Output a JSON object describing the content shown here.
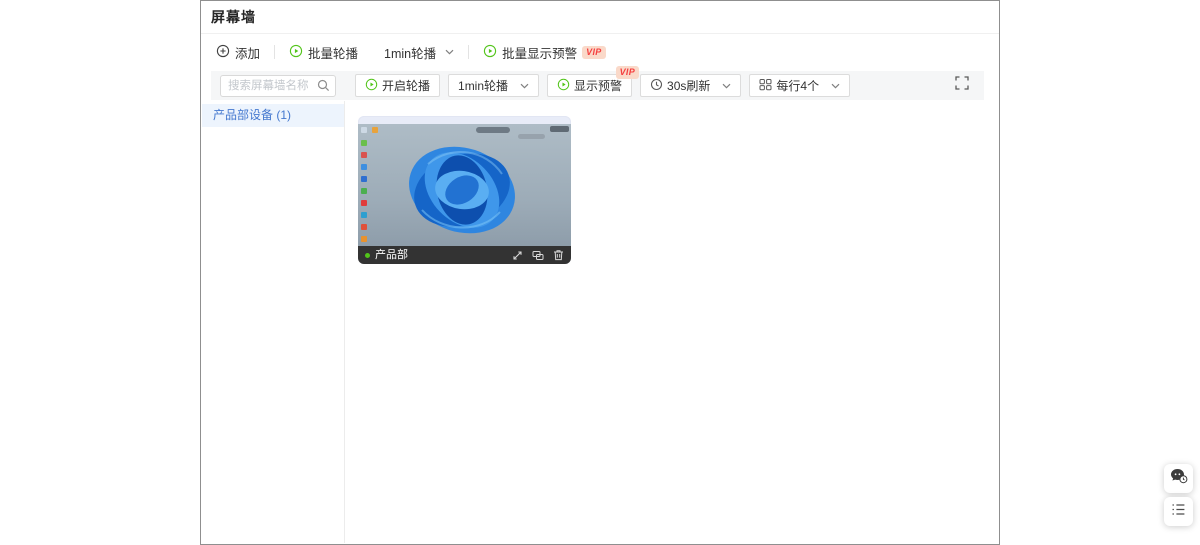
{
  "page": {
    "title": "屏幕墙"
  },
  "toolbar_primary": {
    "add": "添加",
    "batch_carousel": "批量轮播",
    "carousel_interval": "1min轮播",
    "batch_alert_preview": "批量显示预警",
    "vip": "VIP"
  },
  "toolbar_secondary": {
    "search_placeholder": "搜索屏幕墙名称",
    "start_carousel": "开启轮播",
    "carousel_interval": "1min轮播",
    "alert_preview": "显示预警",
    "vip": "VIP",
    "refresh": "30s刷新",
    "per_row": "每行4个"
  },
  "sidebar": {
    "groups": [
      {
        "label": "产品部设备 (1)"
      }
    ]
  },
  "devices": [
    {
      "name": "产品部",
      "status": "online"
    }
  ],
  "colors": {
    "accent_green": "#52c41a",
    "link_blue": "#4478cf",
    "vip_red": "#f53f3f",
    "vip_bg": "#fad9c9",
    "bar_dark": "#333333"
  }
}
